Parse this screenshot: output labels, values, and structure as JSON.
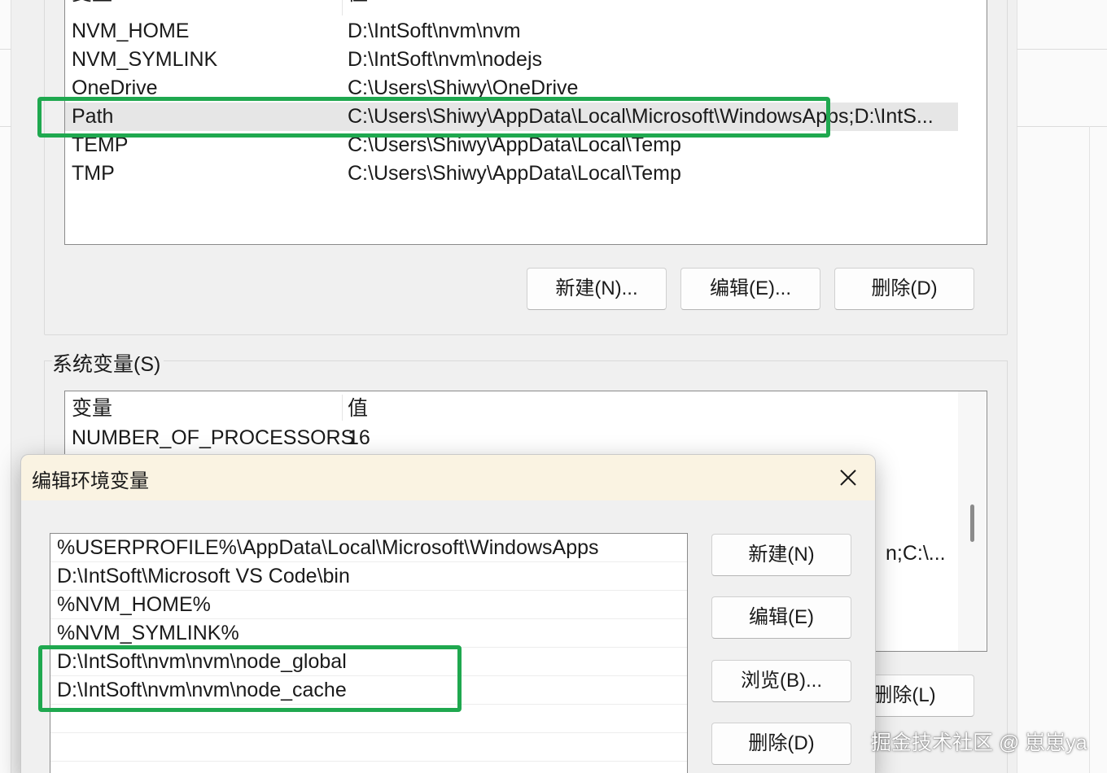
{
  "env_dialog": {
    "user_vars": {
      "header": {
        "name": "变量",
        "value": "值"
      },
      "rows": [
        {
          "name": "NVM_HOME",
          "value": "D:\\IntSoft\\nvm\\nvm"
        },
        {
          "name": "NVM_SYMLINK",
          "value": "D:\\IntSoft\\nvm\\nodejs"
        },
        {
          "name": "OneDrive",
          "value": "C:\\Users\\Shiwy\\OneDrive"
        },
        {
          "name": "Path",
          "value": "C:\\Users\\Shiwy\\AppData\\Local\\Microsoft\\WindowsApps;D:\\IntS..."
        },
        {
          "name": "TEMP",
          "value": "C:\\Users\\Shiwy\\AppData\\Local\\Temp"
        },
        {
          "name": "TMP",
          "value": "C:\\Users\\Shiwy\\AppData\\Local\\Temp"
        }
      ],
      "selected": "Path",
      "buttons": {
        "new": "新建(N)...",
        "edit": "编辑(E)...",
        "delete": "删除(D)"
      }
    },
    "system_vars": {
      "label": "系统变量(S)",
      "header": {
        "name": "变量",
        "value": "值"
      },
      "rows": [
        {
          "name": "NUMBER_OF_PROCESSORS",
          "value": "16"
        }
      ],
      "partial_value": "n;C:\\...",
      "buttons": {
        "delete": "删除(L)"
      }
    }
  },
  "edit_dialog": {
    "title": "编辑环境变量",
    "paths": [
      "%USERPROFILE%\\AppData\\Local\\Microsoft\\WindowsApps",
      "D:\\IntSoft\\Microsoft VS Code\\bin",
      "%NVM_HOME%",
      "%NVM_SYMLINK%",
      "D:\\IntSoft\\nvm\\nvm\\node_global",
      "D:\\IntSoft\\nvm\\nvm\\node_cache",
      "",
      ""
    ],
    "buttons": {
      "new": "新建(N)",
      "edit": "编辑(E)",
      "browse": "浏览(B)...",
      "delete": "删除(D)"
    }
  },
  "watermark": "掘金技术社区 @ 崽崽ya",
  "colors": {
    "highlight": "#1fa84f",
    "titlebar": "#faf3e2",
    "selected_row": "#e6e6e6"
  }
}
